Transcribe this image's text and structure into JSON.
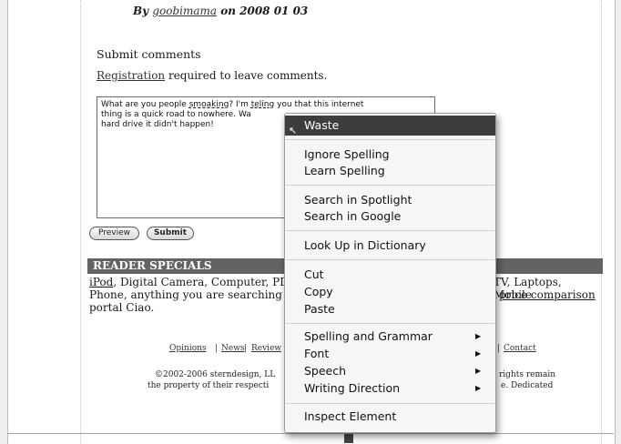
{
  "byline": {
    "prefix": "By",
    "author": "goobimama",
    "suffix": "on 2008 01 03"
  },
  "comments": {
    "heading": "Submit comments",
    "registration_link": "Registration",
    "registration_suffix": "required to leave comments.",
    "text_line1a": "What are you people ",
    "text_misspelled": "smoaking",
    "text_line1b": "? I'm ",
    "text_misspelled2": "teling",
    "text_line1c": " you that this internet",
    "text_line2": "thing is a quick road to nowhere. Wa",
    "text_line3": "hard drive it didn't happen!"
  },
  "buttons": {
    "preview": "Preview",
    "submit": "Submit"
  },
  "specials": {
    "heading": "READER SPECIALS",
    "line1a": "iPod",
    "line1b": ", Digital Camera, Computer, PD",
    "line1c": "TV, Laptops, Mobile",
    "line2a": "Phone, anything you are searching f",
    "line2b": "price comparison",
    "line3": "portal Ciao."
  },
  "footer": {
    "link_opinions": "Opinions",
    "link_news": "News",
    "link_reviews_partial": "Review",
    "link_contact": "Contact",
    "sep": "|",
    "copy_a": "©2002-2006 sterndesign, LL",
    "copy_b": "rights remain",
    "copy_c": "the property of their respecti",
    "copy_d": "e. Dedicated"
  },
  "context_menu": {
    "suggestion": "Waste",
    "ignore_spelling": "Ignore Spelling",
    "learn_spelling": "Learn Spelling",
    "search_spotlight": "Search in Spotlight",
    "search_google": "Search in Google",
    "look_up": "Look Up in Dictionary",
    "cut": "Cut",
    "copy": "Copy",
    "paste": "Paste",
    "spelling_grammar": "Spelling and Grammar",
    "font": "Font",
    "speech": "Speech",
    "writing_direction": "Writing Direction",
    "inspect_element": "Inspect Element",
    "submenu_arrow": "▶"
  }
}
